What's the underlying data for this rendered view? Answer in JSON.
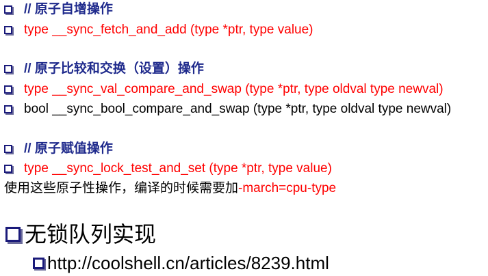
{
  "sections": [
    {
      "header": "// 原子自增操作",
      "items": [
        {
          "text": "type __sync_fetch_and_add (type *ptr, type value)",
          "color": "#ff0000"
        }
      ]
    },
    {
      "header": "// 原子比较和交换（设置）操作",
      "items": [
        {
          "text": "type __sync_val_compare_and_swap (type *ptr, type oldval type newval)",
          "color": "#ff0000"
        },
        {
          "text": "bool __sync_bool_compare_and_swap (type *ptr, type oldval type newval)",
          "color": "#000000"
        }
      ]
    },
    {
      "header": "// 原子赋值操作",
      "items": [
        {
          "text": "type __sync_lock_test_and_set (type *ptr, type value)",
          "color": "#ff0000"
        }
      ]
    }
  ],
  "note": {
    "prefix": "使用这些原子性操作，编译的时候需要加",
    "flag": "-march=cpu-type"
  },
  "topic": {
    "title": "无锁队列实现",
    "link": "http://coolshell.cn/articles/8239.html"
  },
  "colors": {
    "header": "#1f2a8c",
    "highlight": "#ff0000",
    "text": "#000000"
  }
}
